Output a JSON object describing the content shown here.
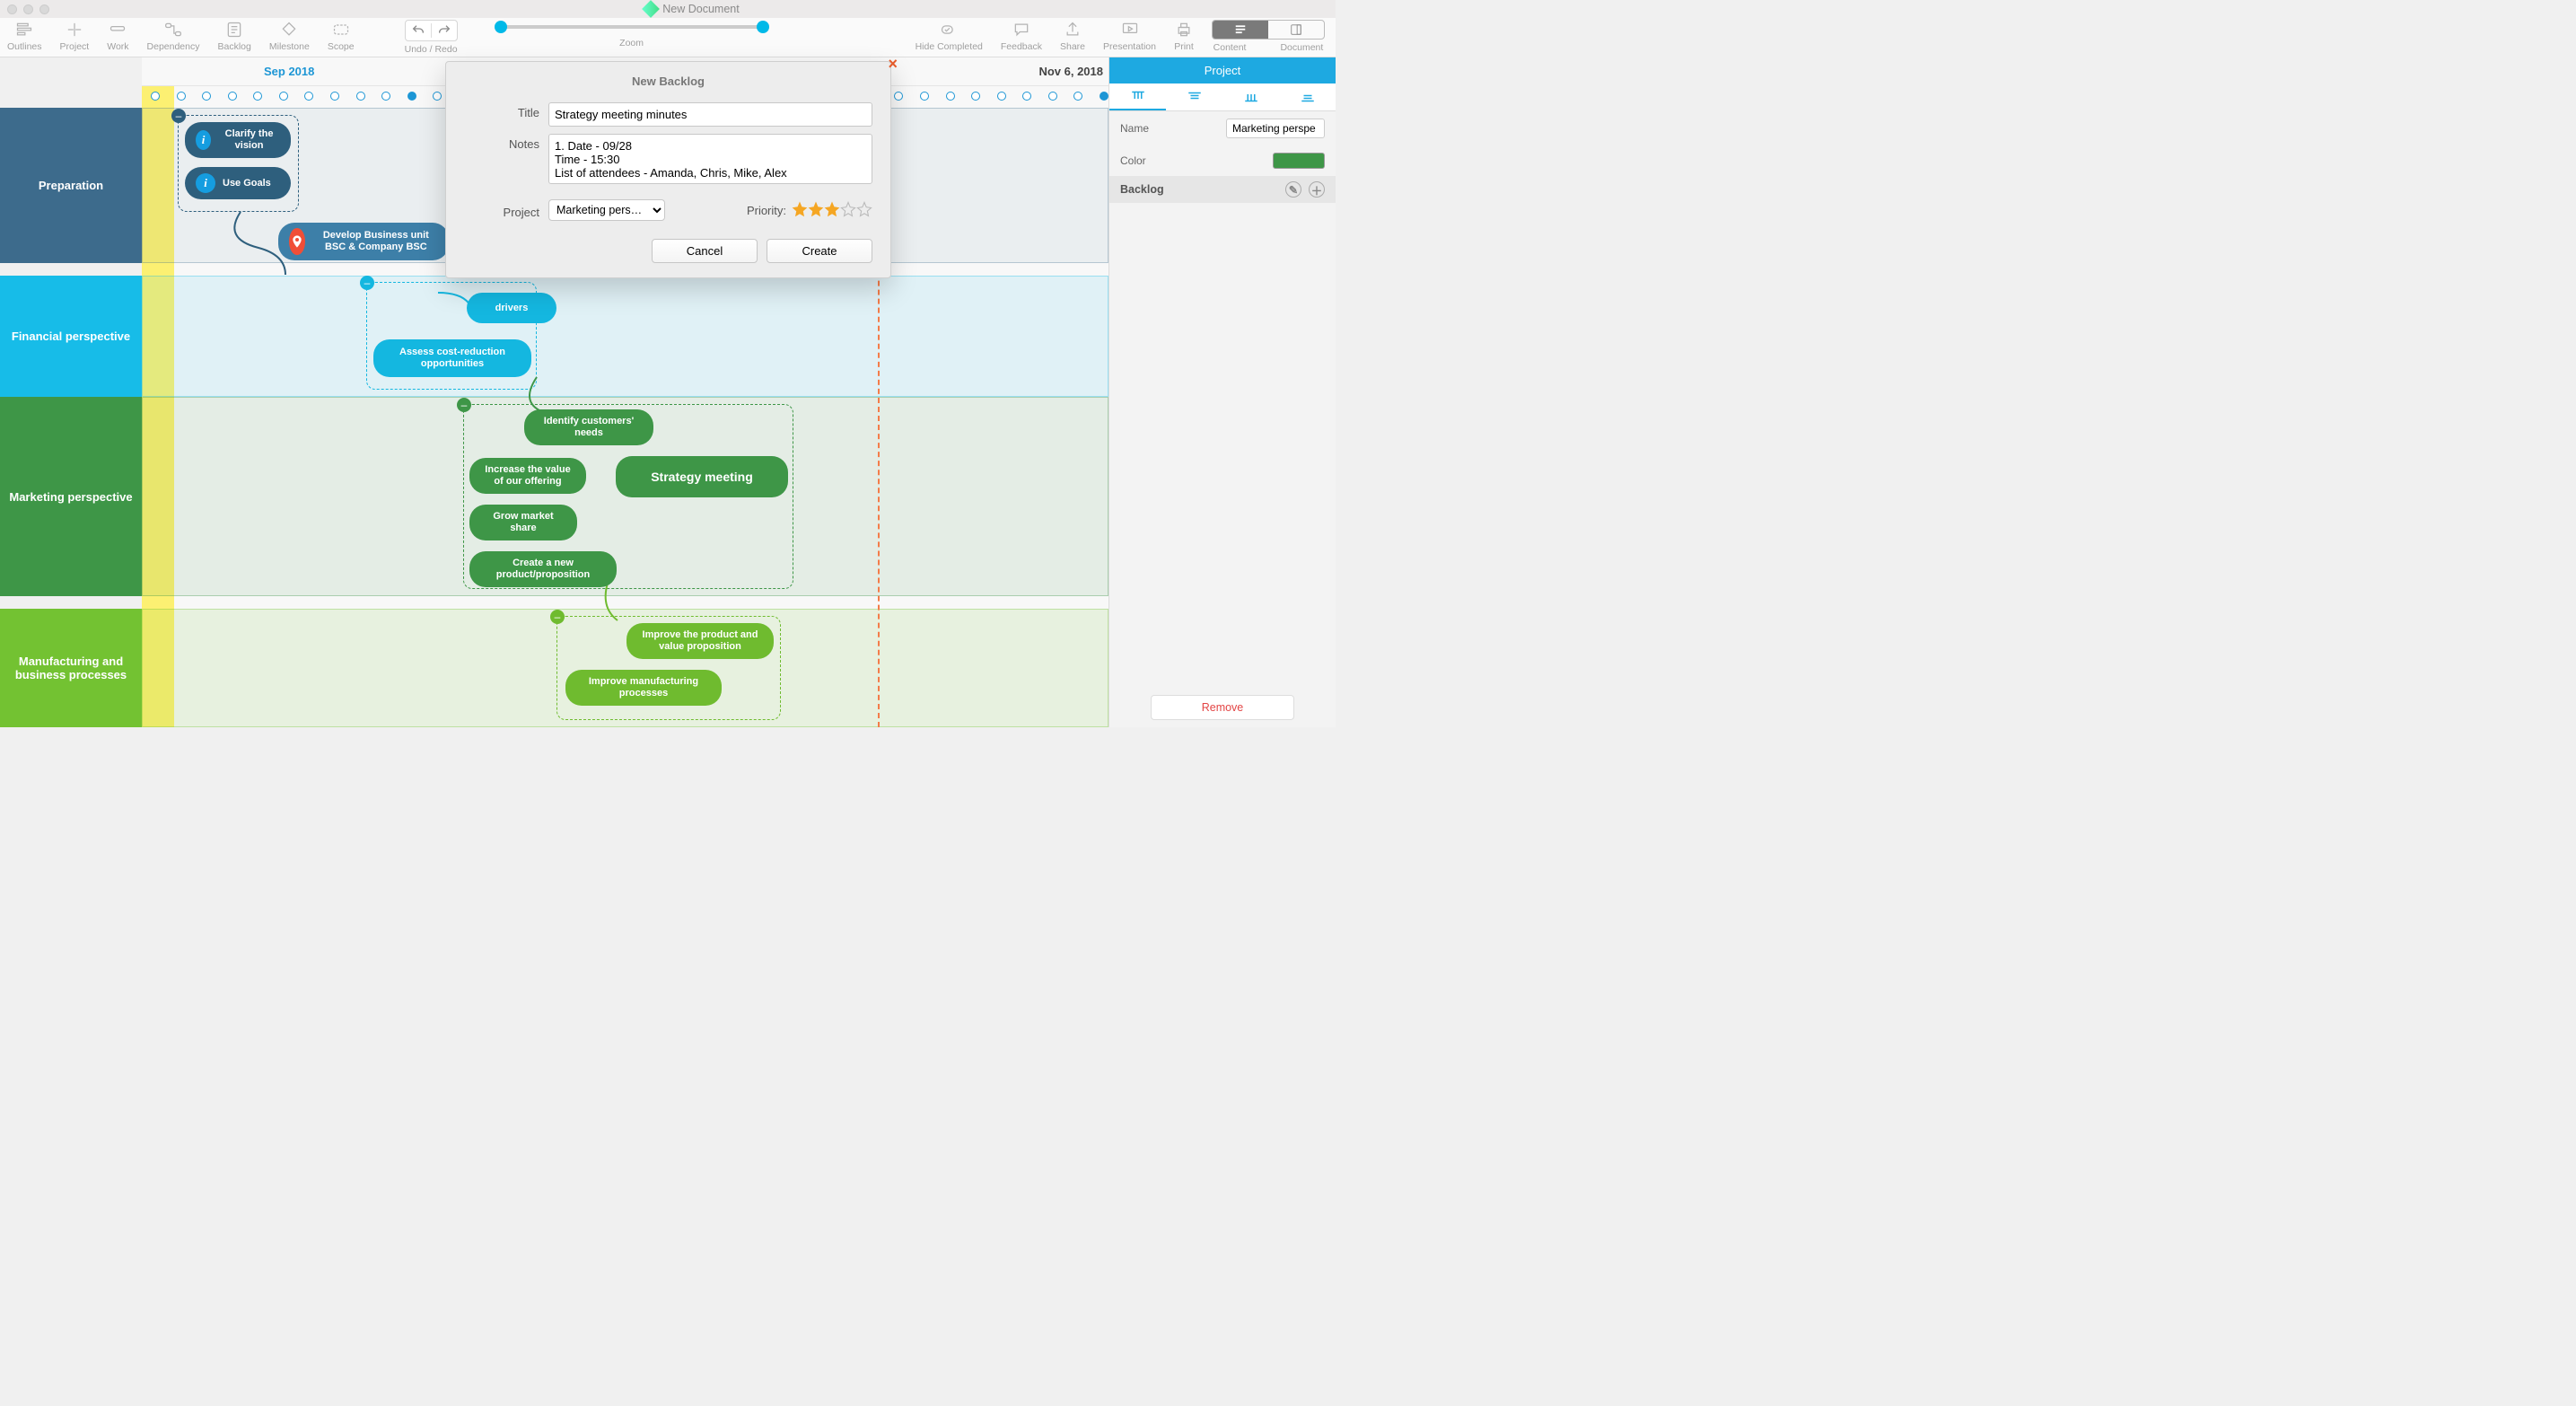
{
  "window_title": "New Document",
  "toolbar": {
    "items_left": [
      "Outlines",
      "Project",
      "Work",
      "Dependency",
      "Backlog",
      "Milestone",
      "Scope"
    ],
    "undo_redo_label": "Undo / Redo",
    "zoom_label": "Zoom",
    "items_right": [
      "Hide Completed",
      "Feedback",
      "Share",
      "Presentation",
      "Print"
    ],
    "segment": {
      "content": "Content",
      "document": "Document"
    }
  },
  "timeline": {
    "left_date": "Sep 2018",
    "right_date": "Nov 6, 2018"
  },
  "lanes": [
    {
      "name": "Preparation"
    },
    {
      "name": "Financial perspective"
    },
    {
      "name": "Marketing perspective"
    },
    {
      "name": "Manufacturing and business processes"
    }
  ],
  "nodes": {
    "clarify": "Clarify the vision",
    "goals": "Use Goals",
    "develop": "Develop Business unit BSC & Company BSC",
    "drivers": "drivers",
    "assess": "Assess cost-reduction opportunities",
    "identify": "Identify customers' needs",
    "increase": "Increase the value of our offering",
    "strategy": "Strategy meeting",
    "grow": "Grow market share",
    "createprod": "Create a new product/proposition",
    "improve1": "Improve the product and value proposition",
    "improve2": "Improve manufacturing processes"
  },
  "dialog": {
    "title": "New Backlog",
    "labels": {
      "title": "Title",
      "notes": "Notes",
      "project": "Project",
      "priority": "Priority:"
    },
    "values": {
      "title": "Strategy meeting minutes",
      "notes": "1. Date - 09/28\nTime - 15:30\nList of attendees - Amanda, Chris, Mike, Alex",
      "project": "Marketing pers…",
      "priority_filled": 3,
      "priority_total": 5
    },
    "buttons": {
      "cancel": "Cancel",
      "create": "Create"
    }
  },
  "sidebar": {
    "title": "Project",
    "name_label": "Name",
    "name_value": "Marketing perspe",
    "color_label": "Color",
    "color_value": "#3e9647",
    "backlog_label": "Backlog",
    "remove": "Remove"
  }
}
